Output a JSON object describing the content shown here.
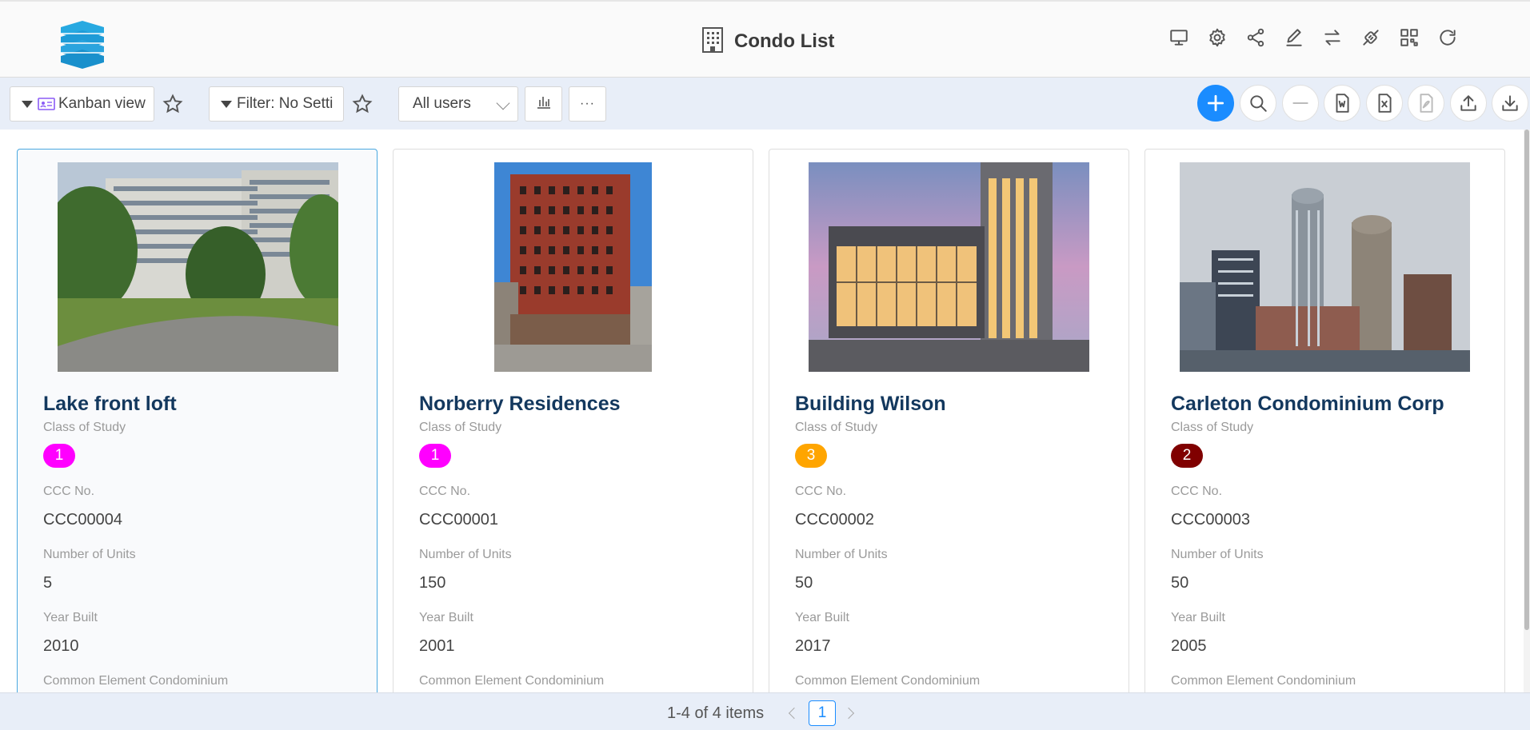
{
  "header": {
    "title": "Condo List",
    "icons": [
      "monitor-icon",
      "gear-icon",
      "share-icon",
      "edit-icon",
      "swap-icon",
      "plug-icon",
      "qr-code-icon",
      "refresh-icon"
    ]
  },
  "toolbar": {
    "view_label": "Kanban view",
    "filter_label": "Filter: No Setti",
    "users_select": "All users",
    "more_label": "···"
  },
  "colors": {
    "accent": "#1a8cff",
    "title_text": "#13385e",
    "badge_magenta": "#ff00ff",
    "badge_orange": "#ffa500",
    "badge_maroon": "#800000"
  },
  "labels": {
    "class": "Class of Study",
    "ccc": "CCC No.",
    "units": "Number of Units",
    "year": "Year Built",
    "common": "Common Element Condominium"
  },
  "cards": [
    {
      "name": "Lake front loft",
      "class_of_study": "1",
      "badge_color": "#ff00ff",
      "ccc_no": "CCC00004",
      "units": "5",
      "year_built": "2010"
    },
    {
      "name": "Norberry Residences",
      "class_of_study": "1",
      "badge_color": "#ff00ff",
      "ccc_no": "CCC00001",
      "units": "150",
      "year_built": "2001"
    },
    {
      "name": "Building Wilson",
      "class_of_study": "3",
      "badge_color": "#ffa500",
      "ccc_no": "CCC00002",
      "units": "50",
      "year_built": "2017"
    },
    {
      "name": "Carleton Condominium Corp",
      "class_of_study": "2",
      "badge_color": "#800000",
      "ccc_no": "CCC00003",
      "units": "50",
      "year_built": "2005"
    }
  ],
  "pagination": {
    "summary": "1-4 of 4 items",
    "current_page": "1"
  }
}
